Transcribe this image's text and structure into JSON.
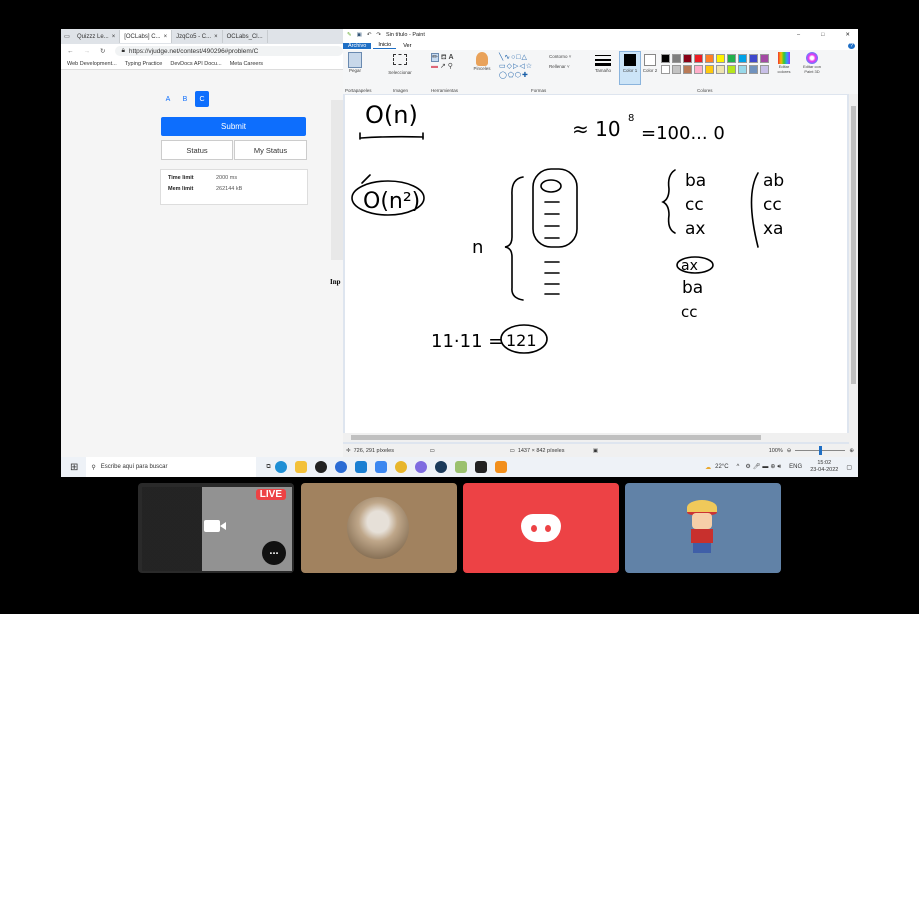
{
  "browser": {
    "tabs": [
      "Quizzz Le...",
      "[OCLabs] C...",
      "JzqCo5 - C...",
      "OCLabs_Cl..."
    ],
    "url": "https://vjudge.net/contest/490296#problem/C",
    "bookmarks": [
      "Web Development...",
      "Typing Practice",
      "DevDocs API Docu...",
      "Meta Careers"
    ]
  },
  "contest_page": {
    "problem_tabs": [
      "A",
      "B",
      "C"
    ],
    "active_tab": "C",
    "submit_label": "Submit",
    "status_label": "Status",
    "my_status_label": "My Status",
    "time_limit_label": "Time limit",
    "time_limit_value": "2000 ms",
    "mem_limit_label": "Mem limit",
    "mem_limit_value": "262144 kB",
    "side_text": "Inp"
  },
  "paint": {
    "title": "Sin título - Paint",
    "menu": [
      "Archivo",
      "Inicio",
      "Ver"
    ],
    "groups": [
      "Portapapeles",
      "Imagen",
      "Herramientas",
      "Formas",
      "Colores"
    ],
    "tools": {
      "paste": "Pegar",
      "select": "Seleccionar",
      "brushes": "Pinceles",
      "outline": "Contorno",
      "fill": "Rellenar",
      "size": "Tamaño",
      "color1": "Color 1",
      "color2": "Color 2",
      "edit_colors": "Editar colores",
      "paint3d": "Editar con Paint 3D"
    },
    "palette": [
      "#000000",
      "#7f7f7f",
      "#880015",
      "#ed1c24",
      "#ff7f27",
      "#fff200",
      "#22b14c",
      "#00a2e8",
      "#3f48cc",
      "#a349a4",
      "#ffffff",
      "#c3c3c3",
      "#b97a57",
      "#ffaec9",
      "#ffc90e",
      "#efe4b0",
      "#b5e61d",
      "#99d9ea",
      "#7092be",
      "#c8bfe7"
    ],
    "status": {
      "cursor": "726, 291 píxeles",
      "size": "1437 × 842 píxeles",
      "zoom": "100%"
    },
    "drawing": {
      "on": "O(n)",
      "approx": "≈ 10",
      "exp": "8",
      "equals": "=100... 0",
      "on2": "O(n²)",
      "n": "n",
      "list1": [
        "ba",
        "cc",
        "ax"
      ],
      "list2": [
        "ab",
        "cc",
        "xa"
      ],
      "sorted": [
        "ax",
        "ba",
        "cc"
      ],
      "mult": "11·11 =",
      "result": "121"
    }
  },
  "taskbar": {
    "search_placeholder": "Escribe aquí para buscar",
    "temp": "22°C",
    "lang": "ENG",
    "time": "15:02",
    "date": "23-04-2022"
  },
  "tiles": {
    "live_badge": "LIVE",
    "more_label": "..."
  },
  "colors": {
    "accent": "#0d6efd",
    "paint_blue": "#1f6fc5",
    "discord": "#ed4245",
    "tile_brown": "#a1825f",
    "tile_blue": "#6182a7"
  }
}
